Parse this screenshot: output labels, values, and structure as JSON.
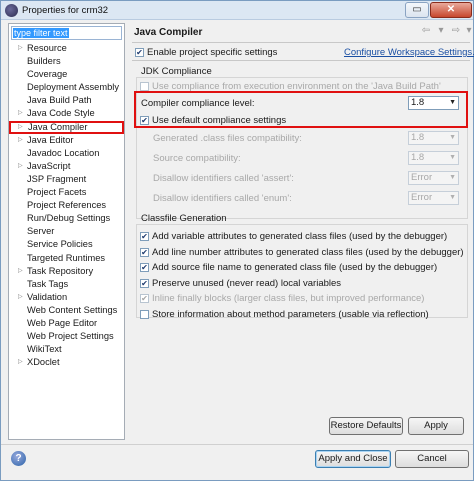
{
  "window": {
    "title": "Properties for crm32",
    "max_glyph": "▭",
    "close_glyph": "✕"
  },
  "filter": {
    "placeholder": "type filter text"
  },
  "tree": {
    "items": [
      {
        "label": "Resource",
        "expandable": true
      },
      {
        "label": "Builders",
        "expandable": false
      },
      {
        "label": "Coverage",
        "expandable": false
      },
      {
        "label": "Deployment Assembly",
        "expandable": false
      },
      {
        "label": "Java Build Path",
        "expandable": false
      },
      {
        "label": "Java Code Style",
        "expandable": true
      },
      {
        "label": "Java Compiler",
        "expandable": true,
        "selected": true
      },
      {
        "label": "Java Editor",
        "expandable": true
      },
      {
        "label": "Javadoc Location",
        "expandable": false
      },
      {
        "label": "JavaScript",
        "expandable": true
      },
      {
        "label": "JSP Fragment",
        "expandable": false
      },
      {
        "label": "Project Facets",
        "expandable": false
      },
      {
        "label": "Project References",
        "expandable": false
      },
      {
        "label": "Run/Debug Settings",
        "expandable": false
      },
      {
        "label": "Server",
        "expandable": false
      },
      {
        "label": "Service Policies",
        "expandable": false
      },
      {
        "label": "Targeted Runtimes",
        "expandable": false
      },
      {
        "label": "Task Repository",
        "expandable": true
      },
      {
        "label": "Task Tags",
        "expandable": false
      },
      {
        "label": "Validation",
        "expandable": true
      },
      {
        "label": "Web Content Settings",
        "expandable": false
      },
      {
        "label": "Web Page Editor",
        "expandable": false
      },
      {
        "label": "Web Project Settings",
        "expandable": false
      },
      {
        "label": "WikiText",
        "expandable": false
      },
      {
        "label": "XDoclet",
        "expandable": true
      }
    ]
  },
  "page": {
    "title": "Java Compiler",
    "nav_back": "⇦",
    "nav_forward": "⇨",
    "nav_menu": "▾",
    "enable_project_specific": "Enable project specific settings",
    "configure_workspace_link": "Configure Workspace Settings...",
    "jdk_compliance_title": "JDK Compliance",
    "use_compliance_from_env": "Use compliance from execution environment on the 'Java Build Path'",
    "compiler_compliance_label": "Compiler compliance level:",
    "compiler_compliance_value": "1.8",
    "use_default_compliance": "Use default compliance settings",
    "generated_class_label": "Generated .class files compatibility:",
    "generated_class_value": "1.8",
    "source_compat_label": "Source compatibility:",
    "source_compat_value": "1.8",
    "disallow_assert_label": "Disallow identifiers called 'assert':",
    "disallow_assert_value": "Error",
    "disallow_enum_label": "Disallow identifiers called 'enum':",
    "disallow_enum_value": "Error",
    "classfile_title": "Classfile Generation",
    "classfile_options": [
      {
        "label": "Add variable attributes to generated class files (used by the debugger)",
        "checked": true,
        "enabled": true
      },
      {
        "label": "Add line number attributes to generated class files (used by the debugger)",
        "checked": true,
        "enabled": true
      },
      {
        "label": "Add source file name to generated class file (used by the debugger)",
        "checked": true,
        "enabled": true
      },
      {
        "label": "Preserve unused (never read) local variables",
        "checked": true,
        "enabled": true
      },
      {
        "label": "Inline finally blocks (larger class files, but improved performance)",
        "checked": true,
        "enabled": false
      },
      {
        "label": "Store information about method parameters (usable via reflection)",
        "checked": false,
        "enabled": true
      }
    ]
  },
  "buttons": {
    "restore_defaults": "Restore Defaults",
    "apply": "Apply",
    "apply_and_close": "Apply and Close",
    "cancel": "Cancel"
  },
  "colors": {
    "highlight_red": "#e01010",
    "selection_blue": "#3399ff",
    "link_blue": "#1a4fa3"
  }
}
